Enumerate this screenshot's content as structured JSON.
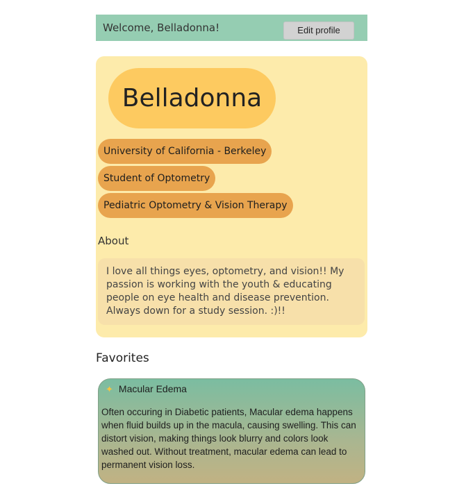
{
  "header": {
    "welcome_text": "Welcome, Belladonna!",
    "edit_profile_label": "Edit profile"
  },
  "profile": {
    "name": "Belladonna",
    "tags": [
      {
        "label": "University of California - Berkeley"
      },
      {
        "label": "Student of Optometry"
      },
      {
        "label": "Pediatric Optometry & Vision Therapy"
      }
    ],
    "about_label": "About",
    "about_text": "I love all things eyes, optometry, and vision!! My passion is working with the youth & educating people on eye health and disease prevention. Always down for a study session. :)!!"
  },
  "favorites": {
    "title": "Favorites",
    "items": [
      {
        "icon": "sparkles-icon",
        "title": "Macular Edema",
        "description": "Often occuring in Diabetic patients, Macular edema happens when fluid builds up in the macula, causing swelling. This can distort vision, making things look blurry and colors look washed out. Without treatment, macular edema can lead to permanent vision loss."
      }
    ]
  },
  "colors": {
    "header_bg": "#95cdb2",
    "card_bg": "#fdebab",
    "name_pill": "#fdca60",
    "tag_bg": "#e8a44e",
    "about_bg": "#f7e0aa"
  }
}
